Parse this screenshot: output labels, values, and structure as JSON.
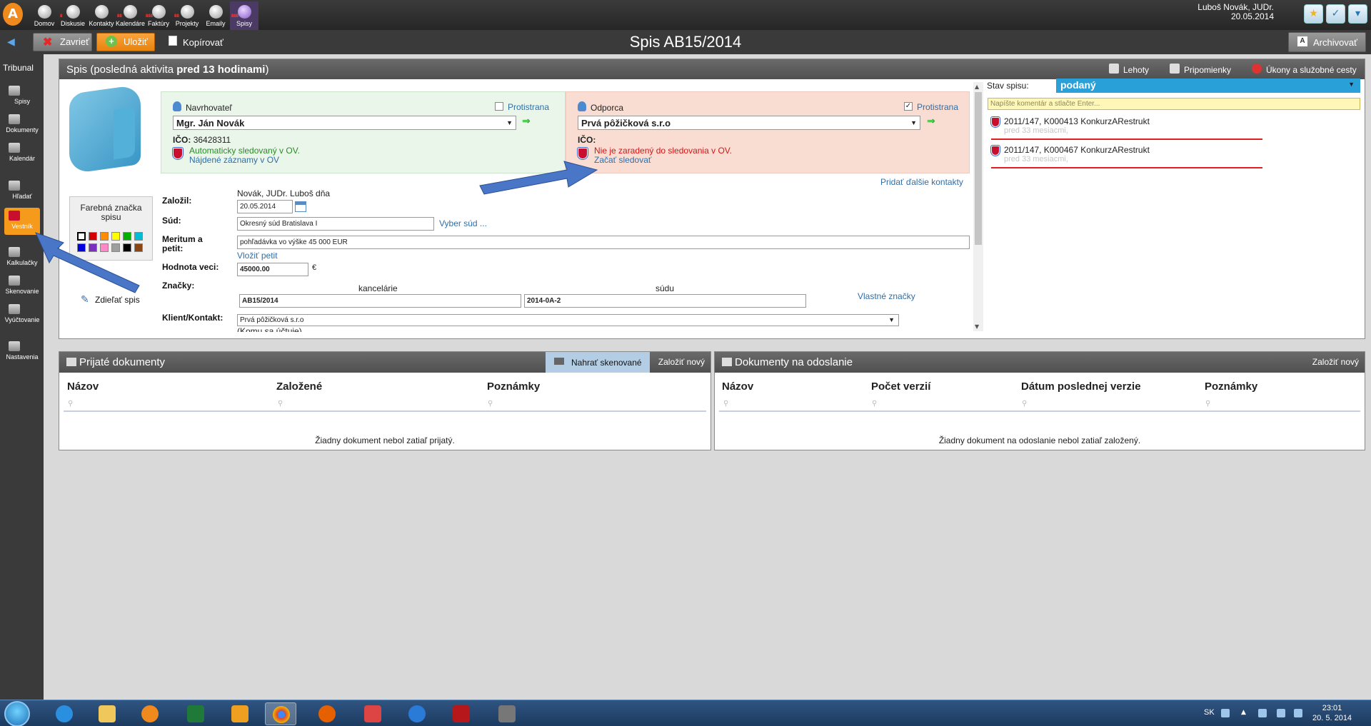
{
  "topbar": {
    "logo": "A",
    "apps": [
      {
        "label": "Domov",
        "badge": "",
        "icon": "home-icon"
      },
      {
        "label": "Diskusie",
        "badge": "8",
        "icon": "discussion-icon"
      },
      {
        "label": "Kontakty",
        "badge": "",
        "icon": "contacts-icon"
      },
      {
        "label": "Kalendáre",
        "badge": "88",
        "icon": "calendar-icon"
      },
      {
        "label": "Faktúry",
        "badge": "888",
        "icon": "invoice-icon"
      },
      {
        "label": "Projekty",
        "badge": "88",
        "icon": "projects-icon"
      },
      {
        "label": "Emaily",
        "badge": "",
        "icon": "email-icon"
      },
      {
        "label": "Spisy",
        "badge": "888",
        "icon": "files-icon"
      }
    ],
    "user_name": "Luboš Novák, JUDr.",
    "user_date": "20.05.2014"
  },
  "toolbar": {
    "close_label": "Zavrieť",
    "save_label": "Uložiť",
    "copy_label": "Kopírovať",
    "title": "Spis AB15/2014",
    "archive_label": "Archivovať"
  },
  "sidebar": {
    "title": "Tribunal",
    "items": [
      {
        "label": "Spisy"
      },
      {
        "label": "Dokumenty"
      },
      {
        "label": "Kalendár"
      },
      {
        "label": "Hľadať"
      },
      {
        "label": "Vestník"
      },
      {
        "label": "Kalkulačky"
      },
      {
        "label": "Skenovanie"
      },
      {
        "label": "Vyúčtovanie"
      },
      {
        "label": "Nastavenia"
      }
    ]
  },
  "main": {
    "header_prefix": "Spis (posledná aktivita ",
    "header_bold": "pred 13 hodinami",
    "header_suffix": ")",
    "header_links": [
      "Lehoty",
      "Pripomienky",
      "Úkony a služobné cesty"
    ],
    "color_box_title": "Farebná značka spisu",
    "colors": [
      "#ffffff",
      "#d40000",
      "#ff8c00",
      "#ffff00",
      "#00b000",
      "#00bcd4",
      "#0000e0",
      "#7b2fbe",
      "#ff88c8",
      "#9e9e9e",
      "#000000",
      "#8b4513"
    ],
    "share_label": "Zdieľať spis",
    "left_party": {
      "role": "Navrhovateľ",
      "counter_label": "Protistrana",
      "counter_checked": "",
      "name": "Mgr. Ján Novák",
      "ico_label": "IČO:",
      "ico_value": "36428311",
      "ov_line1": "Automaticky sledovaný v OV.",
      "ov_line2": "Nájdené záznamy v OV"
    },
    "right_party": {
      "role": "Odporca",
      "counter_label": "Protistrana",
      "counter_checked": "✓",
      "name": "Prvá pôžičková s.r.o",
      "ico_label": "IČO:",
      "ico_value": "",
      "ov_line1": "Nie je zaradený do sledovania v OV.",
      "ov_line2": "Začať sledovať"
    },
    "add_contacts": "Pridať ďalšie kontakty",
    "form": {
      "zalozil_label": "Založil:",
      "zalozil_text": "Novák, JUDr. Luboš dňa",
      "date_value": "20.05.2014",
      "sud_label": "Súd:",
      "sud_value": "Okresný súd Bratislava I",
      "sud_link": "Vyber súd ...",
      "meritum_label": "Meritum a petit:",
      "meritum_value": "pohľadávka vo výške 45 000 EUR",
      "meritum_link": "Vložiť petit",
      "hodnota_label": "Hodnota veci:",
      "hodnota_value": "45000.00",
      "hodnota_unit": "€",
      "znacky_label": "Značky:",
      "znacky_kancelaria_label": "kancelárie",
      "znacky_sud_label": "súdu",
      "znacky_kancelaria": "AB15/2014",
      "znacky_sud": "2014-0A-2",
      "znacky_link": "Vlastné značky",
      "klient_label": "Klient/Kontakt:",
      "klient_value": "Prvá pôžičková s.r.o",
      "klient_sub": "(Komu sa účtuje)"
    },
    "status": {
      "label": "Stav spisu:",
      "value": "podaný",
      "comment_placeholder": "Napíšte komentár a stlačte Enter...",
      "entries": [
        {
          "title": "2011/147, K000413 KonkurzARestrukt",
          "time": "pred 33 mesiacmi,"
        },
        {
          "title": "2011/147, K000467 KonkurzARestrukt",
          "time": "pred 33 mesiacmi,"
        }
      ]
    }
  },
  "received": {
    "title": "Prijaté dokumenty",
    "scan_label": "Nahrať skenované",
    "new_label": "Založiť nový",
    "columns": [
      "Názov",
      "Založené",
      "Poznámky"
    ],
    "empty": "Žiadny dokument nebol zatiaľ prijatý."
  },
  "outgoing": {
    "title": "Dokumenty na odoslanie",
    "new_label": "Založiť nový",
    "columns": [
      "Názov",
      "Počet verzií",
      "Dátum poslednej verzie",
      "Poznámky"
    ],
    "empty": "Žiadny dokument na odoslanie nebol zatiaľ založený."
  },
  "taskbar": {
    "lang": "SK",
    "time": "23:01",
    "date": "20. 5. 2014"
  }
}
